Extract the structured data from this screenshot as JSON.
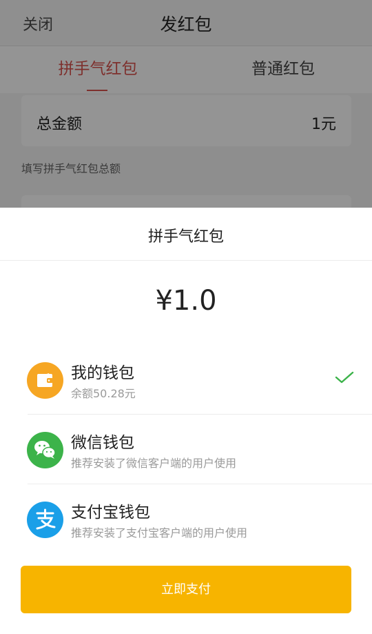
{
  "header": {
    "close_label": "关闭",
    "title": "发红包"
  },
  "tabs": [
    {
      "label": "拼手气红包",
      "active": true
    },
    {
      "label": "普通红包",
      "active": false
    }
  ],
  "form": {
    "amount_label": "总金额",
    "amount_value": "1元",
    "hint": "填写拼手气红包总额"
  },
  "sheet": {
    "title": "拼手气红包",
    "price": "¥1.0",
    "methods": [
      {
        "name": "我的钱包",
        "sub": "余额50.28元",
        "icon": "wallet-icon",
        "color": "#f6a623",
        "selected": true
      },
      {
        "name": "微信钱包",
        "sub": "推荐安装了微信客户端的用户使用",
        "icon": "wechat-icon",
        "color": "#3cb34a",
        "selected": false
      },
      {
        "name": "支付宝钱包",
        "sub": "推荐安装了支付宝客户端的用户使用",
        "icon": "alipay-icon",
        "color": "#1a9fe8",
        "selected": false
      }
    ],
    "pay_label": "立即支付"
  },
  "colors": {
    "accent_red": "#d9534f",
    "pay_yellow": "#f7b400",
    "check_green": "#3cb34a"
  }
}
